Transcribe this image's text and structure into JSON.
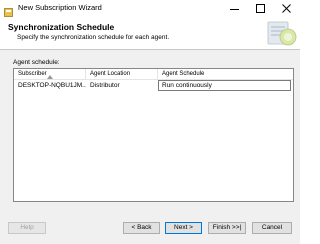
{
  "window": {
    "title": "New Subscription Wizard",
    "accent_color": "#0078d7"
  },
  "header": {
    "title": "Synchronization Schedule",
    "subtitle": "Specify the synchronization schedule for each agent."
  },
  "content": {
    "section_label": "Agent schedule:",
    "grid": {
      "columns": [
        "Subscriber",
        "Agent Location",
        "Agent Schedule"
      ],
      "sorted_column": "Subscriber",
      "rows": [
        {
          "subscriber": "DESKTOP-NQBU1JM...",
          "agent_location": "Distributor",
          "agent_schedule": "Run continuously"
        }
      ]
    }
  },
  "footer": {
    "help_label": "Help",
    "back_label": "< Back",
    "next_label": "Next >",
    "finish_label": "Finish >>|",
    "cancel_label": "Cancel"
  },
  "icons": {
    "app": "wizard-app-icon",
    "header_graphic": "wizard-header-graphic",
    "minimize": "minimize-icon",
    "maximize": "maximize-icon",
    "close": "close-icon",
    "sort": "sort-ascending-icon"
  }
}
